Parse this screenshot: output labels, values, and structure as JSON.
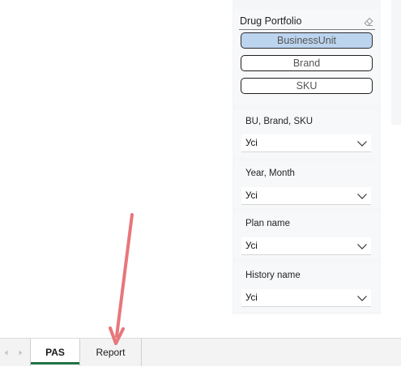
{
  "drug_portfolio": {
    "title": "Drug Portfolio",
    "clear_icon": "eraser-icon",
    "options": [
      {
        "label": "BusinessUnit",
        "selected": true
      },
      {
        "label": "Brand",
        "selected": false
      },
      {
        "label": "SKU",
        "selected": false
      }
    ]
  },
  "slicers": [
    {
      "label": "BU, Brand, SKU",
      "value": "Усі"
    },
    {
      "label": "Year, Month",
      "value": "Усі"
    },
    {
      "label": "Plan name",
      "value": "Усі"
    },
    {
      "label": "History name",
      "value": "Усі"
    }
  ],
  "sheet_tabs": [
    {
      "label": "PAS",
      "active": true
    },
    {
      "label": "Report",
      "active": false
    }
  ],
  "colors": {
    "selected_option": "#bcd4ee",
    "active_tab_underline": "#217346",
    "annotation_arrow": "#e8767a"
  }
}
